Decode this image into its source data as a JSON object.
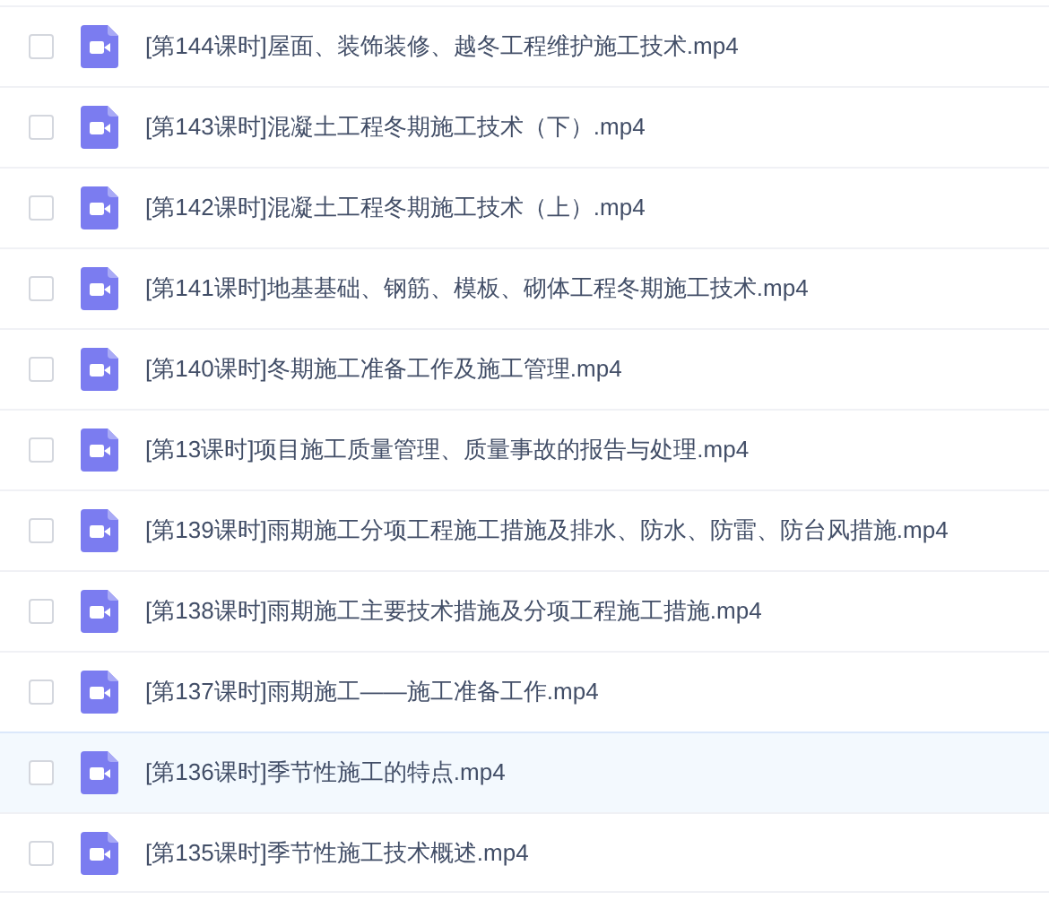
{
  "files": [
    {
      "name": "[第144课时]屋面、装饰装修、越冬工程维护施工技术.mp4",
      "checked": false,
      "highlighted": false
    },
    {
      "name": "[第143课时]混凝土工程冬期施工技术（下）.mp4",
      "checked": false,
      "highlighted": false
    },
    {
      "name": "[第142课时]混凝土工程冬期施工技术（上）.mp4",
      "checked": false,
      "highlighted": false
    },
    {
      "name": "[第141课时]地基基础、钢筋、模板、砌体工程冬期施工技术.mp4",
      "checked": false,
      "highlighted": false
    },
    {
      "name": "[第140课时]冬期施工准备工作及施工管理.mp4",
      "checked": false,
      "highlighted": false
    },
    {
      "name": "[第13课时]项目施工质量管理、质量事故的报告与处理.mp4",
      "checked": false,
      "highlighted": false
    },
    {
      "name": "[第139课时]雨期施工分项工程施工措施及排水、防水、防雷、防台风措施.mp4",
      "checked": false,
      "highlighted": false
    },
    {
      "name": "[第138课时]雨期施工主要技术措施及分项工程施工措施.mp4",
      "checked": false,
      "highlighted": false
    },
    {
      "name": "[第137课时]雨期施工——施工准备工作.mp4",
      "checked": false,
      "highlighted": false
    },
    {
      "name": "[第136课时]季节性施工的特点.mp4",
      "checked": false,
      "highlighted": true
    },
    {
      "name": "[第135课时]季节性施工技术概述.mp4",
      "checked": false,
      "highlighted": false
    }
  ]
}
